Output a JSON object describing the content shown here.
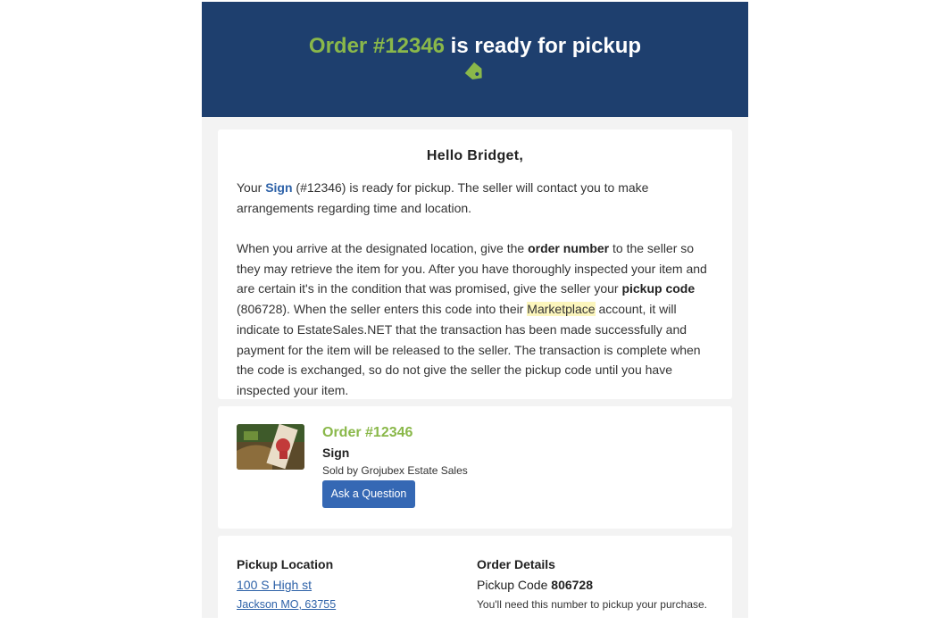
{
  "header": {
    "title_order": "Order #12346",
    "title_rest": " is ready for pickup",
    "icon": "price-tag-icon",
    "bg_color": "#1e3f6e",
    "accent_color": "#8ab84a"
  },
  "greeting_card": {
    "greeting": "Hello Bridget,",
    "para1": {
      "t1": "Your ",
      "item_link": "Sign",
      "t2": " (#12346) is ready for pickup. The seller will contact you to make arrangements regarding time and location."
    },
    "para2": {
      "t1": "When you arrive at the designated location, give the ",
      "b1": "order number",
      "t2": " to the seller so they may retrieve the item for you. After you have thoroughly inspected your item and are certain it's in the condition that was promised, give the seller your ",
      "b2": "pickup code",
      "t3": " (806728). When the seller enters this code into their ",
      "highlight": "Marketplace",
      "t4": " account, it will indicate to EstateSales.NET that the transaction has been made successfully and payment for the item will be released to the seller. The transaction is complete when the code is exchanged, so do not give the seller the pickup code until you have inspected your item."
    }
  },
  "order_card": {
    "order_title": "Order #12346",
    "item_name": "Sign",
    "seller": "Sold by Grojubex Estate Sales",
    "ask_button": "Ask a Question"
  },
  "pickup_card": {
    "location_heading": "Pickup Location",
    "address_line1": "100 S High st",
    "address_line2": "Jackson MO, 63755",
    "details_heading": "Order Details",
    "pickup_code_label": "Pickup Code ",
    "pickup_code_value": "806728",
    "pickup_note": "You'll need this number to pickup your purchase."
  }
}
